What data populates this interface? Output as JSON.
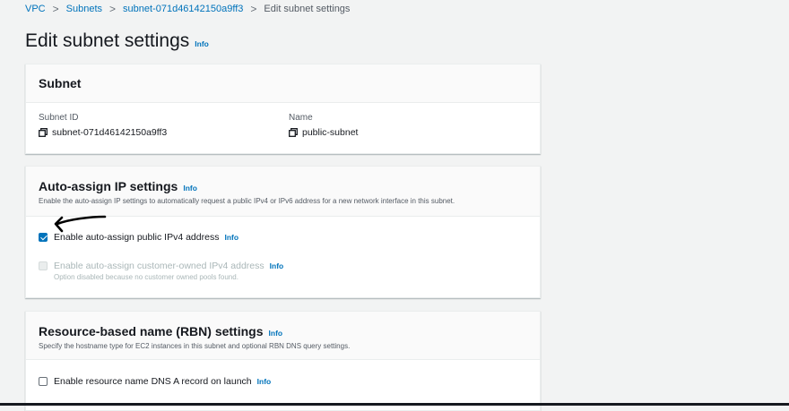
{
  "breadcrumb": {
    "items": [
      "VPC",
      "Subnets",
      "subnet-071d46142150a9ff3"
    ],
    "current": "Edit subnet settings",
    "separator": ">"
  },
  "page": {
    "title": "Edit subnet settings",
    "info": "Info"
  },
  "subnet_panel": {
    "title": "Subnet",
    "subnet_id_label": "Subnet ID",
    "subnet_id_value": "subnet-071d46142150a9ff3",
    "name_label": "Name",
    "name_value": "public-subnet"
  },
  "auto_assign_panel": {
    "title": "Auto-assign IP settings",
    "info": "Info",
    "description": "Enable the auto-assign IP settings to automatically request a public IPv4 or IPv6 address for a new network interface in this subnet.",
    "ipv4_label": "Enable auto-assign public IPv4 address",
    "ipv4_info": "Info",
    "ipv4_checked": true,
    "customer_label": "Enable auto-assign customer-owned IPv4 address",
    "customer_info": "Info",
    "customer_desc": "Option disabled because no customer owned pools found.",
    "customer_checked": false
  },
  "rbn_panel": {
    "title": "Resource-based name (RBN) settings",
    "info": "Info",
    "description": "Specify the hostname type for EC2 instances in this subnet and optional RBN DNS query settings.",
    "dns_a_label": "Enable resource name DNS A record on launch",
    "dns_a_info": "Info",
    "dns_a_checked": false
  },
  "colors": {
    "link": "#0073bb",
    "background": "#f2f3f3",
    "checkbox_checked": "#0073bb"
  }
}
